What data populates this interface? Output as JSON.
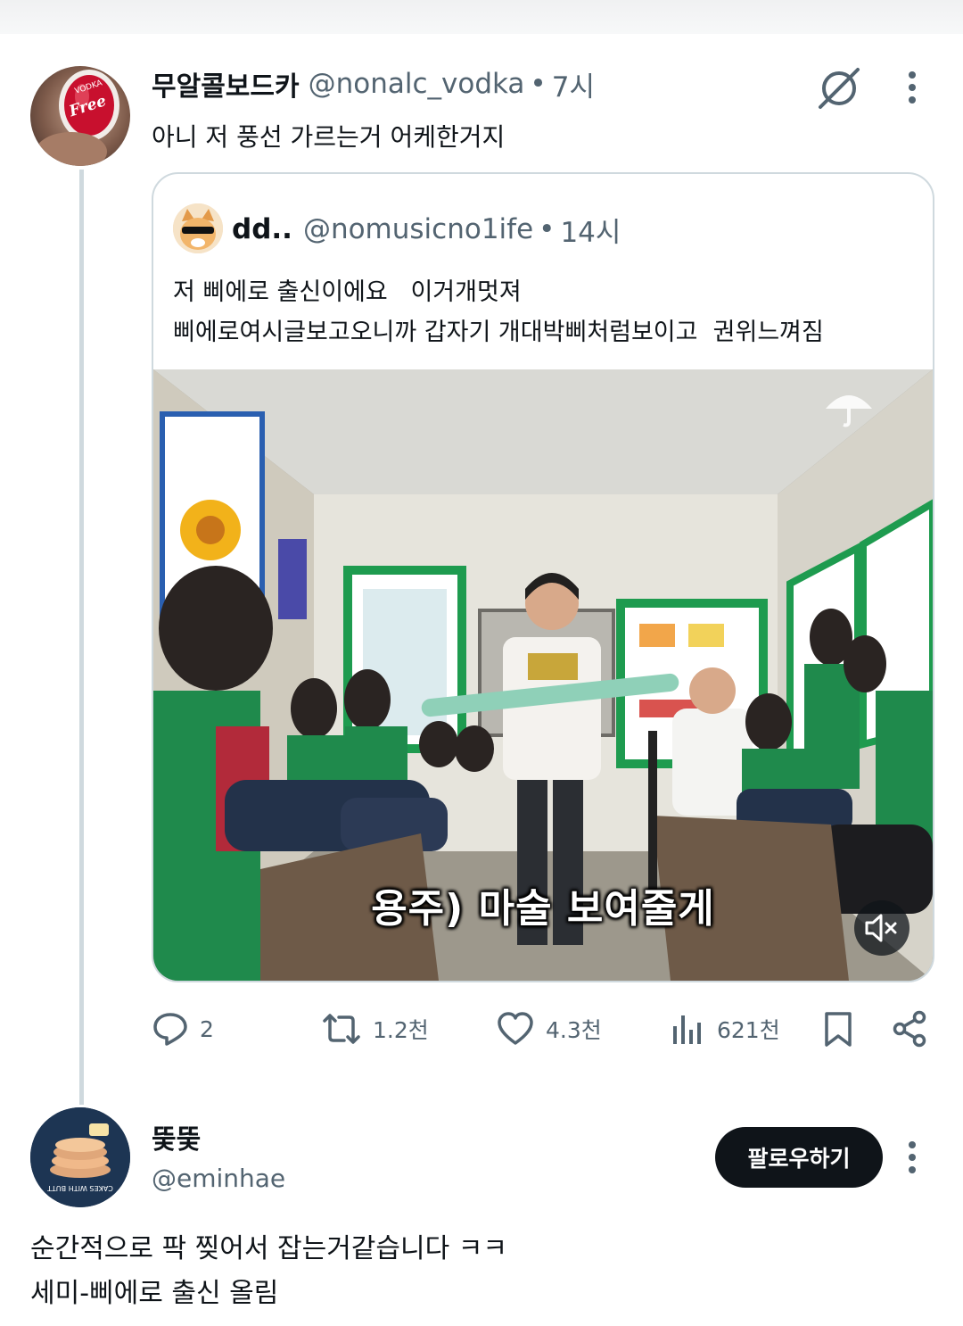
{
  "colors": {
    "text_primary": "#0f1419",
    "text_secondary": "#536471",
    "border": "#cfd9de",
    "follow_button_bg": "#0f1419",
    "follow_button_text": "#ffffff"
  },
  "tweet": {
    "author": {
      "display_name": "무알콜보드카",
      "handle": "@nonalc_vodka",
      "avatar_text": "Free",
      "avatar_text_small": "VODKA"
    },
    "separator": "•",
    "time": "7시",
    "text": "아니 저 풍선 가르는거 어케한거지",
    "icons": {
      "grok": "grok-icon",
      "more": "more-options-icon"
    },
    "quote": {
      "author": {
        "display_name": "dd..",
        "handle": "@nomusicno1ife"
      },
      "separator": "•",
      "time": "14시",
      "text": "저 삐에로 출신이에요   이거개멋져\n삐에로여시글보고오니까 갑자기 개대박삐처럼보이고  권위느껴짐",
      "video": {
        "caption": "용주) 마술 보여줄게",
        "muted": true
      }
    },
    "actions": {
      "reply_count": "2",
      "retweet_count": "1.2천",
      "like_count": "4.3천",
      "view_count": "621천"
    }
  },
  "reply": {
    "author": {
      "display_name": "뚲뚲",
      "handle": "@eminhae",
      "avatar_text": "CAKES WITH BUTT"
    },
    "follow_label": "팔로우하기",
    "text": "순간적으로 팍 찢어서 잡는거같습니다 ㅋㅋ\n세미-삐에로 출신 올림"
  }
}
